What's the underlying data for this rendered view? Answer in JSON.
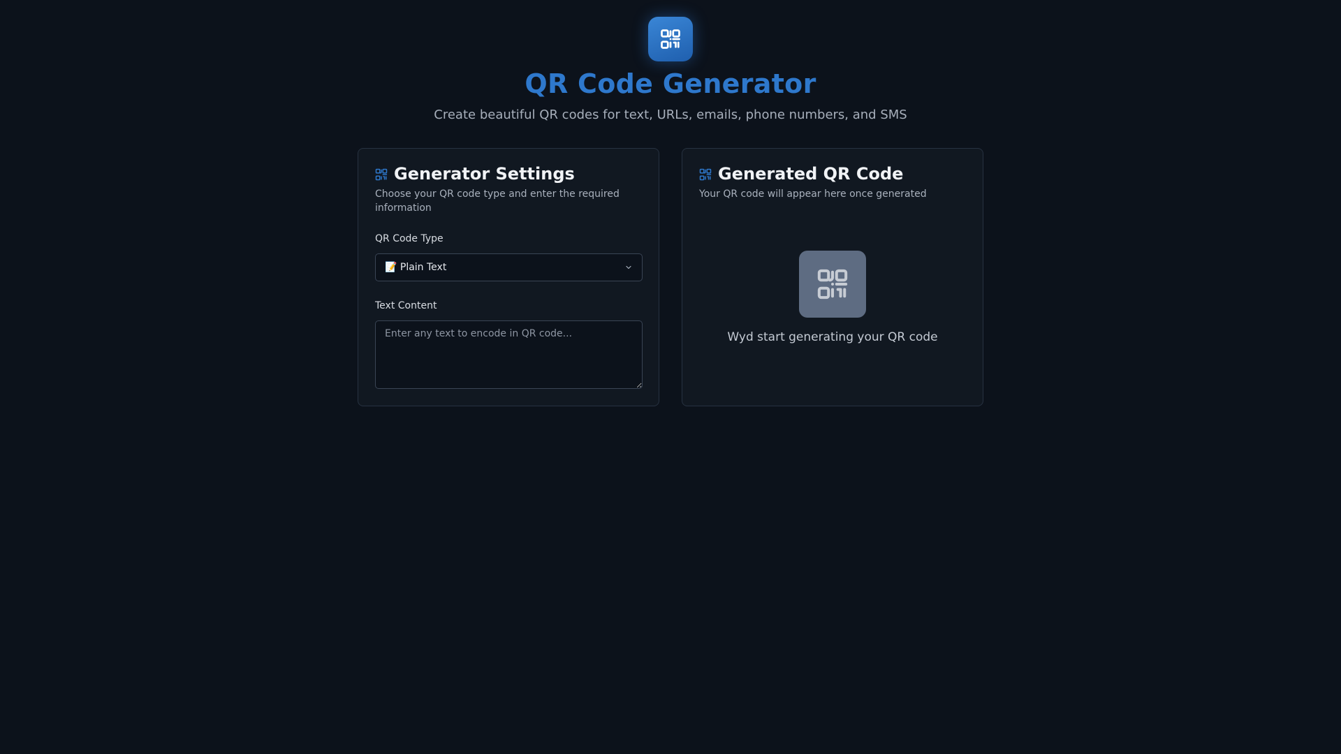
{
  "app": {
    "title": "QR Code Generator",
    "subtitle": "Create beautiful QR codes for text, URLs, emails, phone numbers, and SMS",
    "logo_icon": "qr-code-icon",
    "accent_color": "#2e78cc"
  },
  "settings": {
    "title": "Generator Settings",
    "description": "Choose your QR code type and enter the required information",
    "type_label": "QR Code Type",
    "type_selected": "📝 Plain Text",
    "content_label": "Text Content",
    "content_placeholder": "Enter any text to encode in QR code...",
    "content_value": ""
  },
  "output": {
    "title": "Generated QR Code",
    "description": "Your QR code will appear here once generated",
    "empty_message": "Wyd start generating your QR code"
  }
}
